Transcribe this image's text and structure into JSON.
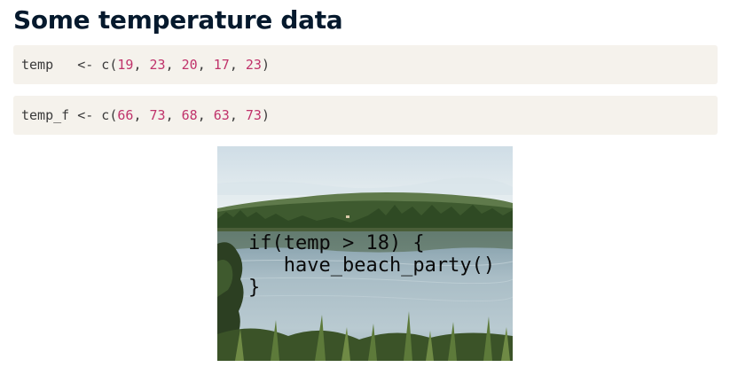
{
  "page": {
    "title": "Some temperature data"
  },
  "code_blocks": [
    {
      "var": "temp",
      "assign": "   <- c(",
      "values": [
        "19",
        "23",
        "20",
        "17",
        "23"
      ]
    },
    {
      "var": "temp_f",
      "assign": " <- c(",
      "values": [
        "66",
        "73",
        "68",
        "63",
        "73"
      ]
    }
  ],
  "syntax": {
    "separator": ", ",
    "close": ")"
  },
  "image": {
    "code_lines": [
      "if(temp > 18) {",
      "   have_beach_party()",
      "}"
    ]
  },
  "colors": {
    "number": "#c0336b",
    "code_background": "#f5f2ec",
    "title": "#05192d"
  }
}
